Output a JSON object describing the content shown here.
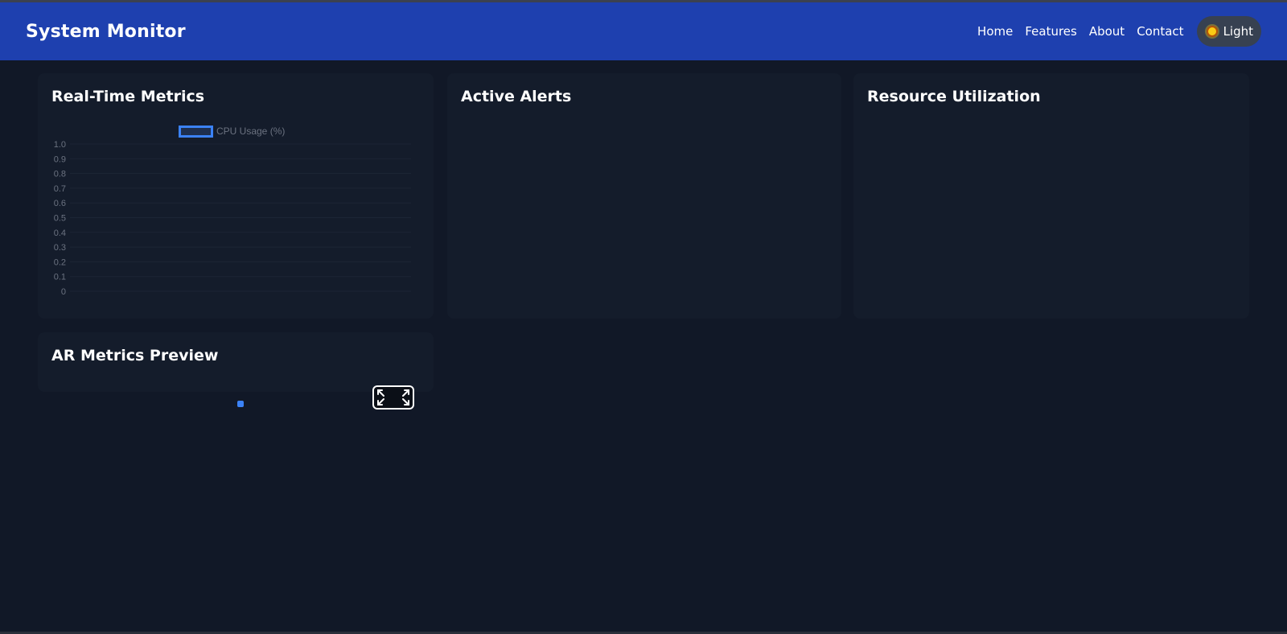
{
  "app": {
    "title": "System Monitor"
  },
  "nav": {
    "links": [
      "Home",
      "Features",
      "About",
      "Contact"
    ],
    "theme_toggle": {
      "label": "Light",
      "icon": "sun-icon"
    }
  },
  "cards": {
    "metrics": {
      "title": "Real-Time Metrics"
    },
    "alerts": {
      "title": "Active Alerts"
    },
    "resources": {
      "title": "Resource Utilization"
    },
    "ar": {
      "title": "AR Metrics Preview",
      "fullscreen_icon": "expand-icon"
    }
  },
  "colors": {
    "navbar": "#1e40af",
    "background": "#111827",
    "card": "#141c2b",
    "accent": "#3b82f6"
  },
  "chart_data": {
    "type": "line",
    "series": [
      {
        "name": "CPU Usage (%)",
        "values": []
      }
    ],
    "x": [],
    "ylim": [
      0,
      1.0
    ],
    "yticks": [
      "1.0",
      "0.9",
      "0.8",
      "0.7",
      "0.6",
      "0.5",
      "0.4",
      "0.3",
      "0.2",
      "0.1",
      "0"
    ],
    "legend": "top-center",
    "grid": true
  }
}
